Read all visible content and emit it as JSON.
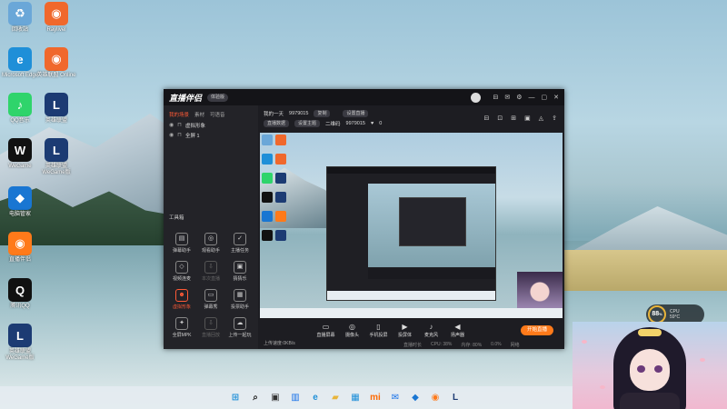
{
  "desktop": {
    "icons": [
      {
        "label": "回收站",
        "glyph": "♻",
        "color": "#6aa7d8"
      },
      {
        "label": "Raylivel",
        "glyph": "◉",
        "color": "#f0682c"
      },
      {
        "label": "Microsoft Edge",
        "glyph": "e",
        "color": "#1f8fd8"
      },
      {
        "label": "英雄联盟 Online",
        "glyph": "◉",
        "color": "#f0682c"
      },
      {
        "label": "QQ音乐",
        "glyph": "♪",
        "color": "#2fd46b"
      },
      {
        "label": "英雄联盟",
        "glyph": "L",
        "color": "#1c3b73"
      },
      {
        "label": "WeGame",
        "glyph": "W",
        "color": "#111111"
      },
      {
        "label": "英雄联盟 WeGame版",
        "glyph": "L",
        "color": "#1c3b73"
      },
      {
        "label": "电脑管家",
        "glyph": "◆",
        "color": "#1976d2"
      },
      {
        "label": "直播伴侣",
        "glyph": "◉",
        "color": "#ff7a1a"
      },
      {
        "label": "腾讯QQ",
        "glyph": "Q",
        "color": "#111111"
      },
      {
        "label": "英雄联盟 WeGame版",
        "glyph": "L",
        "color": "#1c3b73"
      }
    ]
  },
  "app": {
    "logo": "直播伴侣",
    "version": "体验版",
    "title_icons": [
      "⊟",
      "✉",
      "⚙",
      "—",
      "▢",
      "✕"
    ],
    "tabs": [
      "我的场景",
      "素材",
      "可语音"
    ],
    "scenes": [
      "虚拟形象",
      "全屏 1"
    ],
    "tools_title": "工具箱",
    "tools": [
      {
        "label": "弹幕助手",
        "glyph": "▤",
        "state": "normal"
      },
      {
        "label": "观看助手",
        "glyph": "◎",
        "state": "normal"
      },
      {
        "label": "主播任务",
        "glyph": "✓",
        "state": "normal"
      },
      {
        "label": "视频连麦",
        "glyph": "◇",
        "state": "normal"
      },
      {
        "label": "本次直播",
        "glyph": "⇩",
        "state": "dim"
      },
      {
        "label": "猜猜乐",
        "glyph": "▣",
        "state": "normal"
      },
      {
        "label": "虚拟形象",
        "glyph": "☻",
        "state": "red"
      },
      {
        "label": "弹幕秀",
        "glyph": "▭",
        "state": "normal"
      },
      {
        "label": "投票助手",
        "glyph": "▦",
        "state": "normal"
      },
      {
        "label": "全屏MPK",
        "glyph": "✦",
        "state": "normal"
      },
      {
        "label": "直播回放",
        "glyph": "⇩",
        "state": "dim"
      },
      {
        "label": "上传一起玩",
        "glyph": "☁",
        "state": "normal"
      }
    ],
    "room_name": "我的一天",
    "room_id": "9979015",
    "copy_label": "复制",
    "settings_label": "设置直播",
    "row2_left": "直播数据",
    "row2_mid": "设置主题",
    "row2_count_label": "二维码",
    "row2_count": "9979015",
    "row2_likes": "0",
    "main_icons": [
      "⊟",
      "⊡",
      "⊞",
      "▣",
      "◬",
      "⇪"
    ],
    "bottom_buttons": [
      {
        "label": "直播屏幕",
        "glyph": "▭"
      },
      {
        "label": "摄像头",
        "glyph": "◎"
      },
      {
        "label": "手机投屏",
        "glyph": "▯"
      },
      {
        "label": "投屏体",
        "glyph": "▶"
      },
      {
        "label": "麦克风",
        "glyph": "♪"
      },
      {
        "label": "扬声器",
        "glyph": "◀"
      }
    ],
    "start_live": "开始直播",
    "status_left": "上传速度:0KB/s",
    "status_items": [
      "直播时长",
      "CPU: 38%",
      "内存: 80%",
      "0.0%",
      "网络"
    ]
  },
  "widget": {
    "value": "88",
    "unit": "%",
    "text1": "CPU",
    "text2": "59°C"
  },
  "taskbar": {
    "items": [
      {
        "name": "windows-icon",
        "glyph": "⊞",
        "color": "#1f8fd8"
      },
      {
        "name": "search-icon",
        "glyph": "⌕",
        "color": "#222222"
      },
      {
        "name": "task-view-icon",
        "glyph": "▣",
        "color": "#333333"
      },
      {
        "name": "widgets-icon",
        "glyph": "▥",
        "color": "#1a73e8"
      },
      {
        "name": "edge-icon",
        "glyph": "e",
        "color": "#1f8fd8"
      },
      {
        "name": "folder-icon",
        "glyph": "▰",
        "color": "#e8b43a"
      },
      {
        "name": "store-icon",
        "glyph": "▦",
        "color": "#1f8fd8"
      },
      {
        "name": "mi-icon",
        "glyph": "mi",
        "color": "#ff6a00"
      },
      {
        "name": "mail-icon",
        "glyph": "✉",
        "color": "#1a73e8"
      },
      {
        "name": "shield-icon",
        "glyph": "◆",
        "color": "#1976d2"
      },
      {
        "name": "live-companion-icon",
        "glyph": "◉",
        "color": "#ff7a1a"
      },
      {
        "name": "league-icon",
        "glyph": "L",
        "color": "#1c3b73"
      }
    ]
  }
}
